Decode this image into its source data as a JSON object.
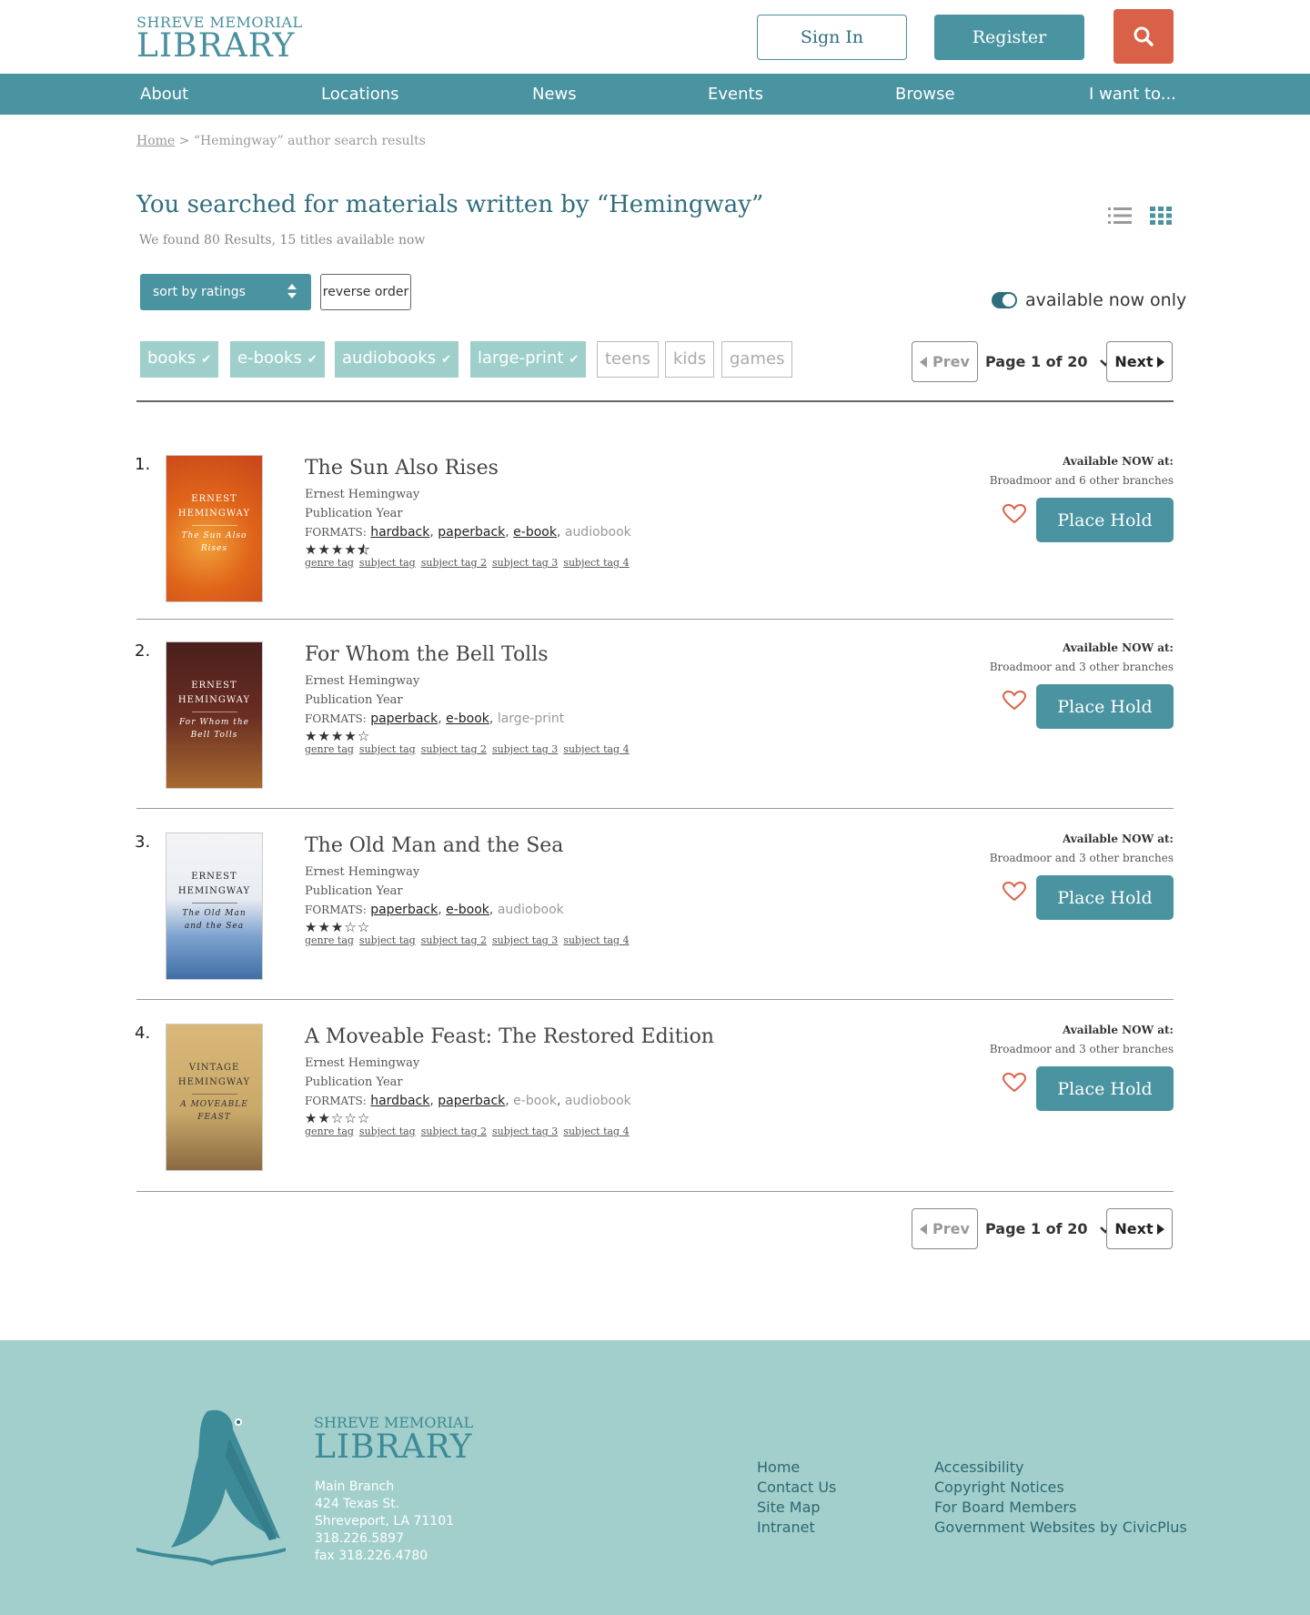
{
  "header": {
    "logo_small": "SHREVE MEMORIAL",
    "logo_big": "LIBRARY",
    "signin_label": "Sign In",
    "register_label": "Register",
    "search_icon": "search-icon",
    "accent_color": "#4a93a1",
    "search_color": "#d96147"
  },
  "nav": {
    "items": [
      "About",
      "Locations",
      "News",
      "Events",
      "Browse",
      "I want to..."
    ]
  },
  "breadcrumb": {
    "home": "Home",
    "separator": ">",
    "current": "“Hemingway” author search results"
  },
  "search": {
    "title": "You searched for materials written by “Hemingway”",
    "result_count": "We found 80 Results, 15 titles available now"
  },
  "controls": {
    "sort_label": "sort by ratings",
    "reverse_label": "reverse order",
    "available_only_label": "available now only",
    "available_only_on": true,
    "filters": [
      {
        "label": "books",
        "active": true
      },
      {
        "label": "e-books",
        "active": true
      },
      {
        "label": "audiobooks",
        "active": true
      },
      {
        "label": "large-print",
        "active": true
      },
      {
        "label": "teens",
        "active": false
      },
      {
        "label": "kids",
        "active": false
      },
      {
        "label": "games",
        "active": false
      }
    ]
  },
  "pagination": {
    "prev_label": "Prev",
    "page_label": "Page 1 of 20",
    "next_label": "Next"
  },
  "results": [
    {
      "num": "1.",
      "title": "The Sun Also Rises",
      "author": "Ernest Hemingway",
      "pub_year": "Publication Year",
      "formats_label": "FORMATS:",
      "formats": [
        {
          "label": "hardback",
          "available": true
        },
        {
          "label": "paperback",
          "available": true
        },
        {
          "label": "e-book",
          "available": true
        },
        {
          "label": "audiobook",
          "available": false
        }
      ],
      "rating": 4.5,
      "tags": [
        "genre tag",
        "subject tag",
        "subject tag 2",
        "subject tag 3",
        "subject tag 4"
      ],
      "avail_label": "Available NOW at:",
      "avail_branches": "Broadmoor and 6 other branches",
      "hold_label": "Place Hold",
      "cover": {
        "line1": "ERNEST",
        "line2": "HEMINGWAY",
        "subtitle": "The Sun Also Rises",
        "bg": "#e0651a"
      }
    },
    {
      "num": "2.",
      "title": "For Whom the Bell Tolls",
      "author": "Ernest Hemingway",
      "pub_year": "Publication Year",
      "formats_label": "FORMATS:",
      "formats": [
        {
          "label": "paperback",
          "available": true
        },
        {
          "label": "e-book",
          "available": true
        },
        {
          "label": "large-print",
          "available": false
        }
      ],
      "rating": 4,
      "tags": [
        "genre tag",
        "subject tag",
        "subject tag 2",
        "subject tag 3",
        "subject tag 4"
      ],
      "avail_label": "Available NOW at:",
      "avail_branches": "Broadmoor and 3 other branches",
      "hold_label": "Place Hold",
      "cover": {
        "line1": "ERNEST",
        "line2": "HEMINGWAY",
        "subtitle": "For Whom the Bell Tolls",
        "bg": "#5a2a22"
      }
    },
    {
      "num": "3.",
      "title": "The Old Man and the Sea",
      "author": "Ernest Hemingway",
      "pub_year": "Publication Year",
      "formats_label": "FORMATS:",
      "formats": [
        {
          "label": "paperback",
          "available": true
        },
        {
          "label": "e-book",
          "available": true
        },
        {
          "label": "audiobook",
          "available": false
        }
      ],
      "rating": 3,
      "tags": [
        "genre tag",
        "subject tag",
        "subject tag 2",
        "subject tag 3",
        "subject tag 4"
      ],
      "avail_label": "Available NOW at:",
      "avail_branches": "Broadmoor and 3 other branches",
      "hold_label": "Place Hold",
      "cover": {
        "line1": "ERNEST",
        "line2": "HEMINGWAY",
        "subtitle": "The Old Man and the Sea",
        "bg": "#4f7fb8"
      }
    },
    {
      "num": "4.",
      "title": "A Moveable Feast: The Restored Edition",
      "author": "Ernest Hemingway",
      "pub_year": "Publication Year",
      "formats_label": "FORMATS:",
      "formats": [
        {
          "label": "hardback",
          "available": true
        },
        {
          "label": "paperback",
          "available": true
        },
        {
          "label": "e-book",
          "available": false
        },
        {
          "label": "audiobook",
          "available": false
        }
      ],
      "rating": 2,
      "tags": [
        "genre tag",
        "subject tag",
        "subject tag 2",
        "subject tag 3",
        "subject tag 4"
      ],
      "avail_label": "Available NOW at:",
      "avail_branches": "Broadmoor and 3 other branches",
      "hold_label": "Place Hold",
      "cover": {
        "line1": "VINTAGE",
        "line2": "HEMINGWAY",
        "subtitle": "A MOVEABLE FEAST",
        "bg": "#c9a86a"
      }
    }
  ],
  "footer": {
    "logo_small": "SHREVE MEMORIAL",
    "logo_big": "LIBRARY",
    "address": [
      "Main Branch",
      "424 Texas St.",
      "Shreveport, LA 71101",
      "318.226.5897",
      "fax 318.226.4780"
    ],
    "links_col1": [
      "Home",
      "Contact Us",
      "Site Map",
      "Intranet"
    ],
    "links_col2": [
      "Accessibility",
      "Copyright Notices",
      "For Board Members",
      "Government Websites by CivicPlus"
    ],
    "bg_color": "#a2cfcb"
  }
}
